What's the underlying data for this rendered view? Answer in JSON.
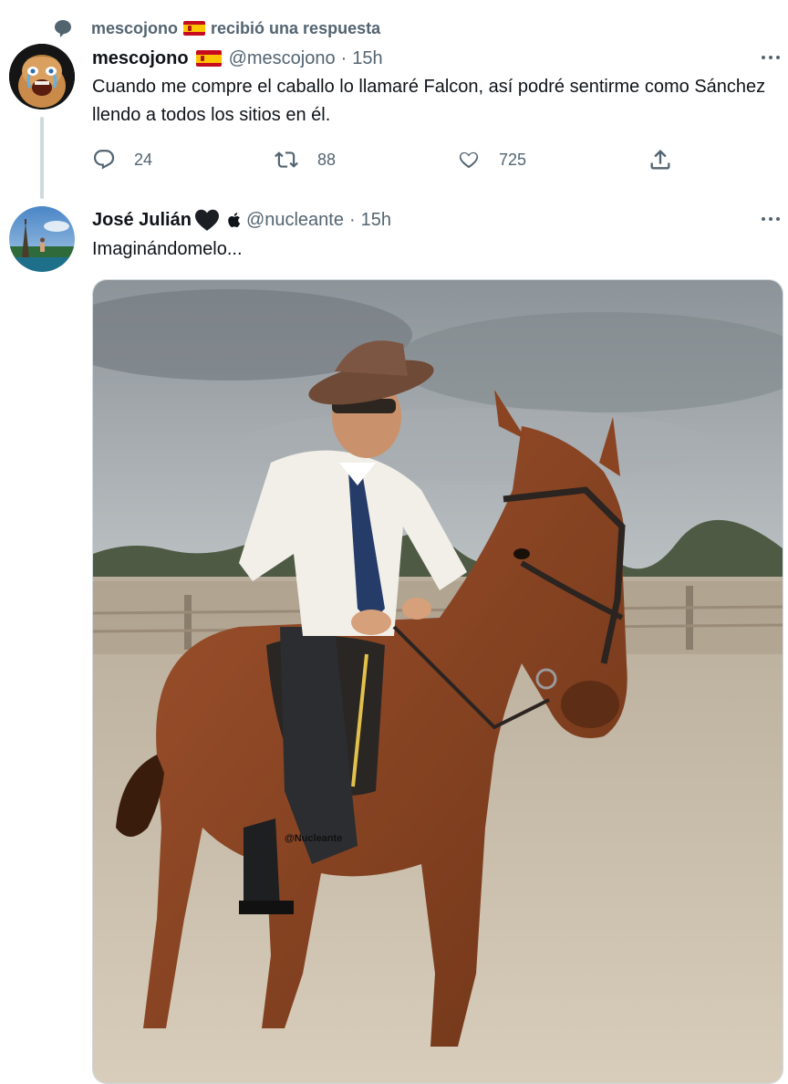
{
  "context": {
    "user": "mescojono",
    "text": "recibió una respuesta"
  },
  "tweet1": {
    "name": "mescojono",
    "handle": "@mescojono",
    "separator": "·",
    "time": "15h",
    "text": "Cuando me compre el caballo lo llamaré Falcon, así podré sentirme como Sánchez llendo a todos los sitios en él.",
    "replies": "24",
    "retweets": "88",
    "likes": "725"
  },
  "tweet2": {
    "name": "José Julián",
    "handle": "@nucleante",
    "separator": "·",
    "time": "15h",
    "text": "Imaginándomelo...",
    "image_watermark": "@Nucleante"
  },
  "icons": {
    "context": "speech-bubble-icon",
    "reply": "reply-icon",
    "retweet": "retweet-icon",
    "like": "heart-icon",
    "share": "share-icon",
    "more": "more-dots-icon",
    "heart_emoji": "black-heart-icon",
    "apple": "apple-icon",
    "flag": "spain-flag-icon"
  },
  "colors": {
    "text_primary": "#0f1419",
    "text_secondary": "#536471",
    "thread_line": "#cfd9de"
  }
}
